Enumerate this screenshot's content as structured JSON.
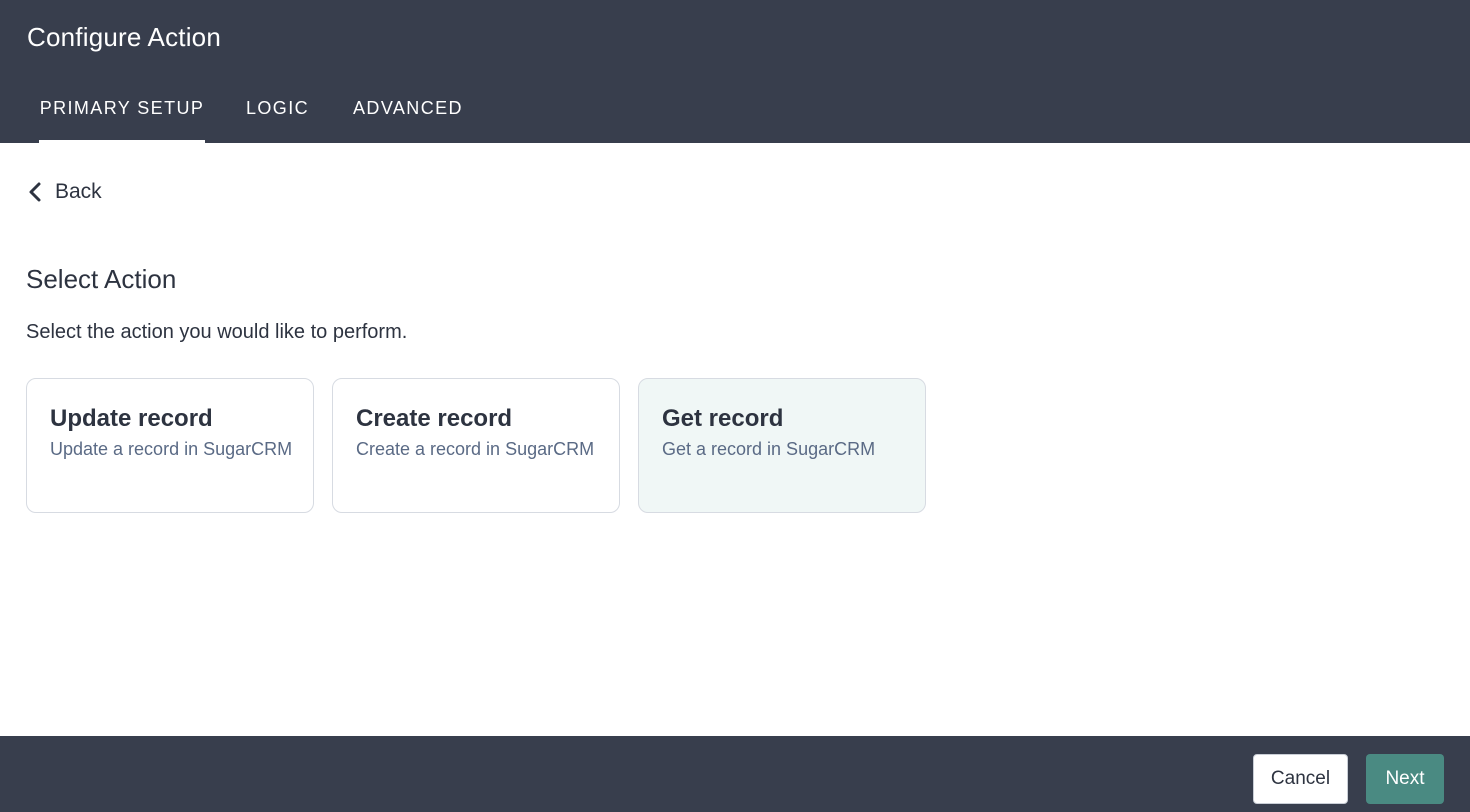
{
  "header": {
    "title": "Configure Action",
    "tabs": [
      {
        "label": "PRIMARY SETUP",
        "active": true
      },
      {
        "label": "LOGIC",
        "active": false
      },
      {
        "label": "ADVANCED",
        "active": false
      }
    ]
  },
  "back": {
    "label": "Back",
    "icon": "chevron-left-icon"
  },
  "main": {
    "title": "Select Action",
    "description": "Select the action you would like to perform.",
    "cards": [
      {
        "title": "Update record",
        "description": "Update a record in SugarCRM",
        "selected": false
      },
      {
        "title": "Create record",
        "description": "Create a record in SugarCRM",
        "selected": false
      },
      {
        "title": "Get record",
        "description": "Get a record in SugarCRM",
        "selected": true
      }
    ]
  },
  "footer": {
    "cancel_label": "Cancel",
    "next_label": "Next"
  },
  "colors": {
    "header_bg": "#383e4d",
    "accent": "#4a8a82",
    "selected_card_bg": "#f0f7f6"
  }
}
